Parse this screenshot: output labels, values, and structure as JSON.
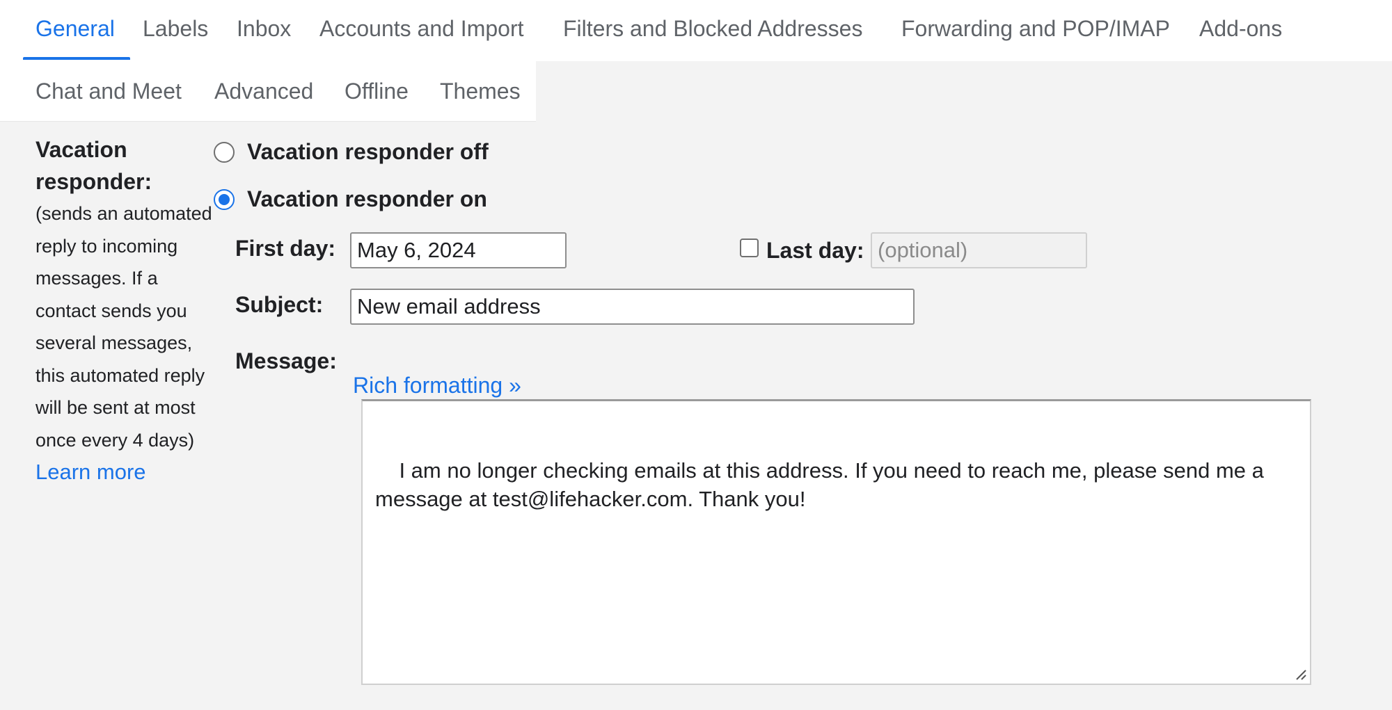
{
  "tabs": [
    {
      "label": "General",
      "active": true
    },
    {
      "label": "Labels"
    },
    {
      "label": "Inbox"
    },
    {
      "label": "Accounts and Import"
    },
    {
      "label": "Filters and Blocked Addresses"
    },
    {
      "label": "Forwarding and POP/IMAP"
    },
    {
      "label": "Add-ons"
    },
    {
      "label": "Chat and Meet"
    },
    {
      "label": "Advanced"
    },
    {
      "label": "Offline"
    },
    {
      "label": "Themes"
    }
  ],
  "vacation": {
    "title": "Vacation responder:",
    "description": "(sends an automated reply to incoming messages. If a contact sends you several messages, this automated reply will be sent at most once every 4 days)",
    "learn_more": "Learn more",
    "off_label": "Vacation responder off",
    "on_label": "Vacation responder on",
    "selected": "on",
    "first_day_label": "First day:",
    "first_day_value": "May 6, 2024",
    "last_day_label": "Last day:",
    "last_day_placeholder": "(optional)",
    "last_day_checked": false,
    "subject_label": "Subject:",
    "subject_value": "New email address",
    "message_label": "Message:",
    "rich_formatting": "Rich formatting »",
    "message_text": "I am no longer checking emails at this address. If you need to reach me, please send me a message at test@lifehacker.com. Thank you!"
  },
  "colors": {
    "accent": "#1a73e8",
    "tab_text": "#5f6368",
    "page_bg": "#f3f3f3"
  }
}
